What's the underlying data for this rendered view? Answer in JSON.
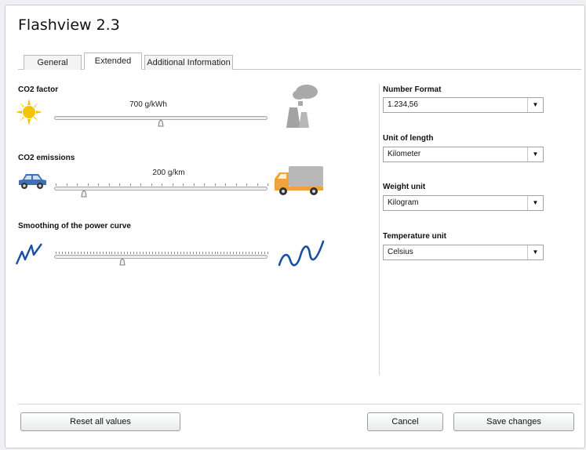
{
  "app": {
    "title": "Flashview 2.3"
  },
  "tabs": [
    {
      "label": "General",
      "active": false
    },
    {
      "label": "Extended",
      "active": true
    },
    {
      "label": "Additional Information",
      "active": false
    }
  ],
  "co2_factor": {
    "label": "CO2 factor",
    "value_text": "700 g/kWh",
    "level": 0.5
  },
  "co2_emissions": {
    "label": "CO2 emissions",
    "value_text": "200 g/km",
    "level": 0.14
  },
  "smoothing": {
    "label": "Smoothing of the power curve",
    "level": 0.32
  },
  "settings": {
    "number_format": {
      "label": "Number Format",
      "value": "1.234,56"
    },
    "unit_length": {
      "label": "Unit of length",
      "value": "Kilometer"
    },
    "weight_unit": {
      "label": "Weight unit",
      "value": "Kilogram"
    },
    "temperature_unit": {
      "label": "Temperature unit",
      "value": "Celsius"
    }
  },
  "buttons": {
    "reset": "Reset all values",
    "cancel": "Cancel",
    "save": "Save changes"
  },
  "colors": {
    "sun": "#f5c400",
    "blue_wave": "#1a4fa3",
    "car": "#3f6fb5",
    "truck": "#f0a23c"
  }
}
